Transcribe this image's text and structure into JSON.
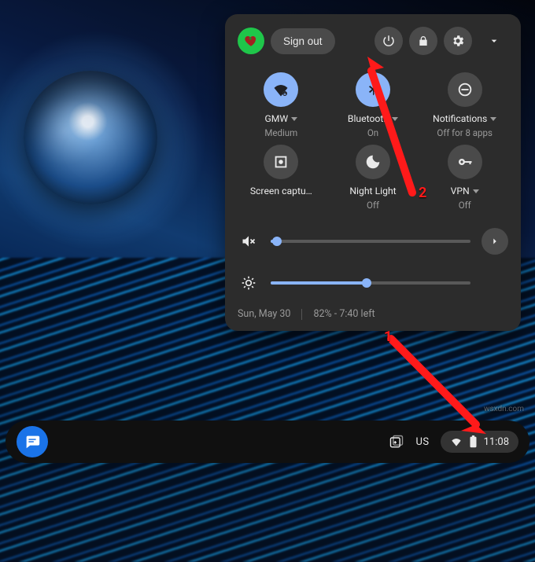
{
  "header": {
    "signout_label": "Sign out"
  },
  "tiles": {
    "wifi": {
      "label": "GMW",
      "sub": "Medium"
    },
    "bluetooth": {
      "label": "Bluetooth",
      "sub": "On"
    },
    "notifications": {
      "label": "Notifications",
      "sub": "Off for 8 apps"
    },
    "screencap": {
      "label": "Screen captu…",
      "sub": ""
    },
    "nightlight": {
      "label": "Night Light",
      "sub": "Off"
    },
    "vpn": {
      "label": "VPN",
      "sub": "Off"
    }
  },
  "footer": {
    "date": "Sun, May 30",
    "battery_status": "82% - 7:40 left"
  },
  "shelf": {
    "ime": "US",
    "clock": "11:08"
  },
  "callouts": {
    "one": "1",
    "two": "2"
  },
  "watermark": "wsxdn.com"
}
